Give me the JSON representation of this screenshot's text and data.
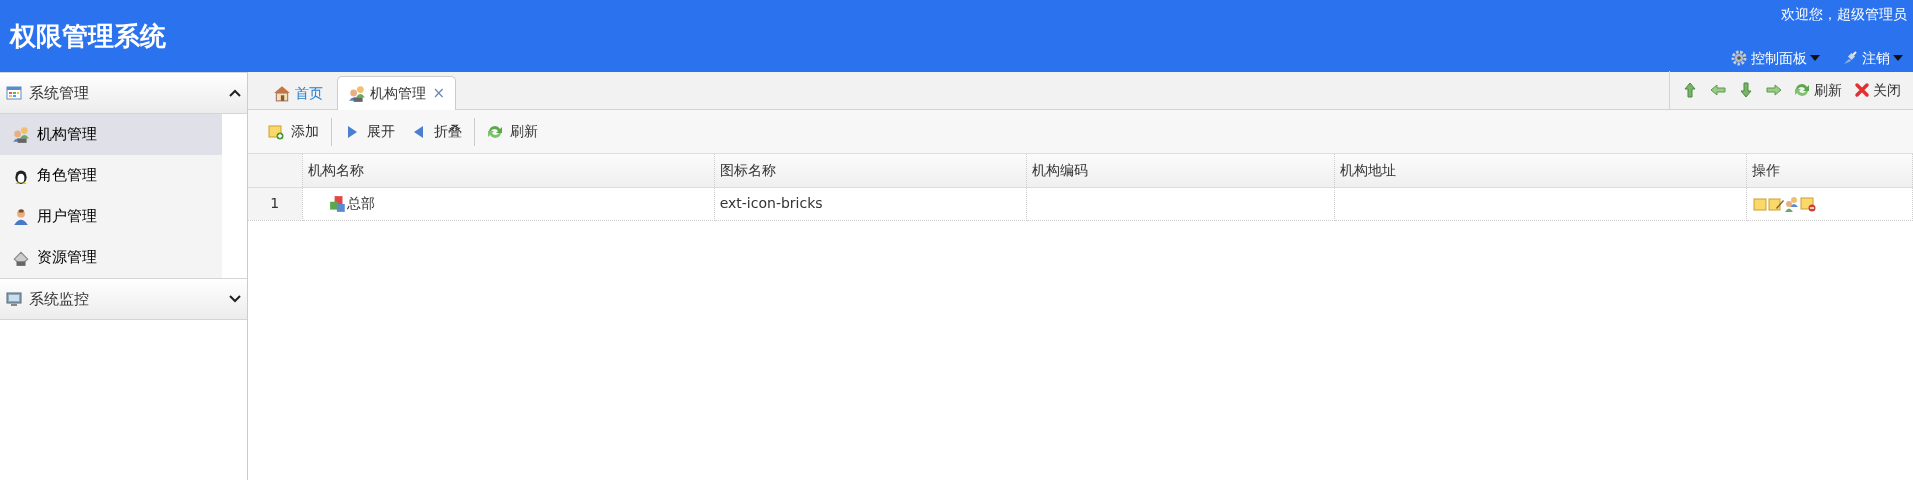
{
  "header": {
    "title": "权限管理系统",
    "welcome": "欢迎您，超级管理员",
    "menus": [
      {
        "label": "控制面板"
      },
      {
        "label": "注销"
      }
    ]
  },
  "sidebar": {
    "groups": [
      {
        "label": "系统管理",
        "expanded": true,
        "items": [
          {
            "label": "机构管理",
            "selected": true
          },
          {
            "label": "角色管理",
            "selected": false
          },
          {
            "label": "用户管理",
            "selected": false
          },
          {
            "label": "资源管理",
            "selected": false
          }
        ]
      },
      {
        "label": "系统监控",
        "expanded": false
      }
    ]
  },
  "tabs": [
    {
      "label": "首页",
      "selected": false
    },
    {
      "label": "机构管理",
      "selected": true,
      "close": "×"
    }
  ],
  "tab_tools": [
    {
      "label": "刷新"
    },
    {
      "label": "关闭"
    }
  ],
  "toolbar": [
    {
      "kind": "button",
      "label": "添加"
    },
    {
      "kind": "separator"
    },
    {
      "kind": "button",
      "label": "展开"
    },
    {
      "kind": "button",
      "label": "折叠"
    },
    {
      "kind": "separator"
    },
    {
      "kind": "button",
      "label": "刷新"
    }
  ],
  "table": {
    "columns": [
      "机构名称",
      "图标名称",
      "机构编码",
      "机构地址",
      "操作"
    ],
    "rows": [
      {
        "index": "1",
        "name": "总部",
        "icon_name": "ext-icon-bricks"
      }
    ]
  }
}
